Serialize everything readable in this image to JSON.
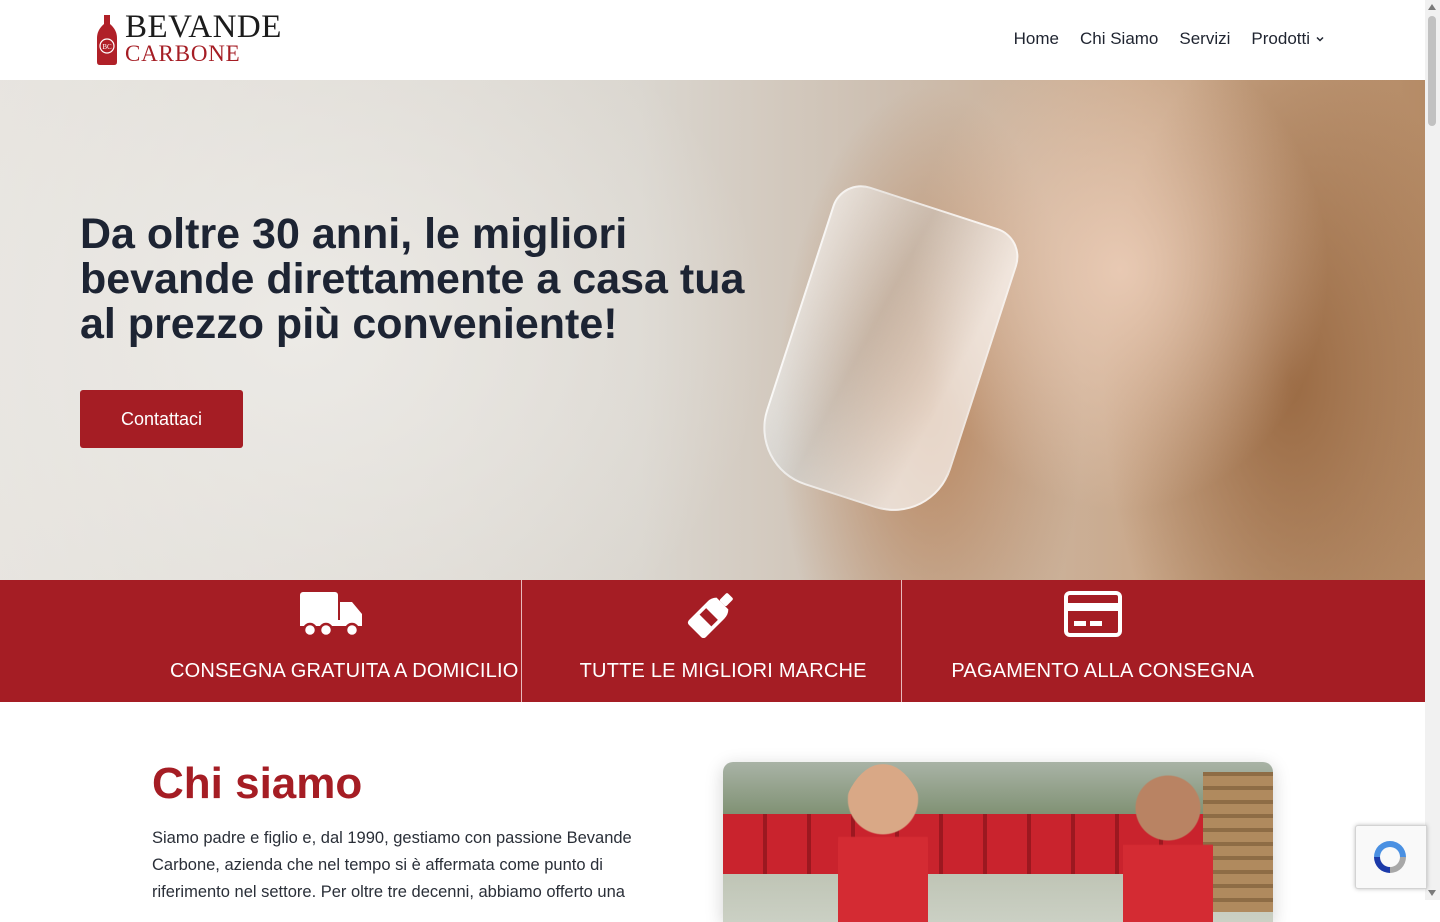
{
  "header": {
    "logo": {
      "top": "BEVANDE",
      "bottom": "CARBONE",
      "bottle_mark": "BC"
    },
    "nav": [
      {
        "label": "Home"
      },
      {
        "label": "Chi Siamo"
      },
      {
        "label": "Servizi"
      },
      {
        "label": "Prodotti",
        "has_dropdown": true
      }
    ]
  },
  "hero": {
    "title": "Da oltre 30 anni, le migliori bevande direttamente a casa tua al prezzo più conveniente!",
    "cta_label": "Contattaci"
  },
  "features": [
    {
      "icon": "truck-icon",
      "label": "CONSEGNA GRATUITA A DOMICILIO"
    },
    {
      "icon": "bottle-icon",
      "label": "TUTTE LE MIGLIORI MARCHE"
    },
    {
      "icon": "credit-card-icon",
      "label": "PAGAMENTO ALLA CONSEGNA"
    }
  ],
  "about": {
    "title": "Chi siamo",
    "text": "Siamo padre e figlio e, dal 1990, gestiamo con passione Bevande Carbone, azienda che nel tempo si è affermata come punto di riferimento nel settore. Per oltre tre decenni, abbiamo offerto una"
  },
  "colors": {
    "brand_red": "#a51d24",
    "text_dark": "#1d2433"
  }
}
